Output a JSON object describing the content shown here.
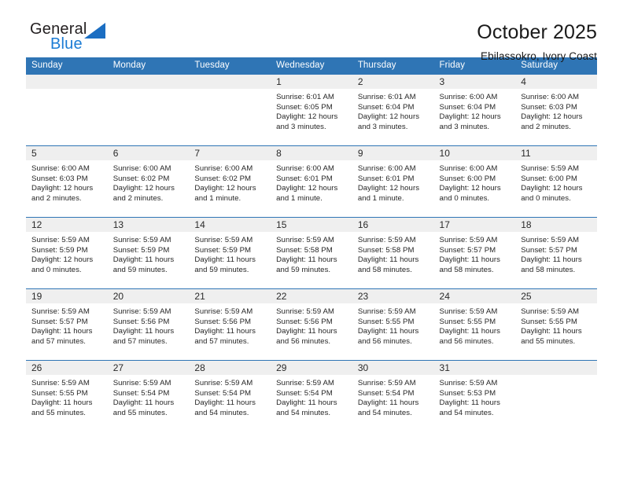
{
  "brand": {
    "name_top": "General",
    "name_bottom": "Blue",
    "triangle_color": "#1b6ec2",
    "blue_color": "#1b7bd4"
  },
  "header": {
    "title": "October 2025",
    "location": "Ebilassokro, Ivory Coast"
  },
  "theme": {
    "header_blue": "#2f75b5",
    "daynum_gray": "#efefef"
  },
  "calendar": {
    "weekdays": [
      "Sunday",
      "Monday",
      "Tuesday",
      "Wednesday",
      "Thursday",
      "Friday",
      "Saturday"
    ],
    "weeks": [
      [
        {
          "day": "",
          "blank": true
        },
        {
          "day": "",
          "blank": true
        },
        {
          "day": "",
          "blank": true
        },
        {
          "day": "1",
          "sunrise": "Sunrise: 6:01 AM",
          "sunset": "Sunset: 6:05 PM",
          "daylight": "Daylight: 12 hours and 3 minutes."
        },
        {
          "day": "2",
          "sunrise": "Sunrise: 6:01 AM",
          "sunset": "Sunset: 6:04 PM",
          "daylight": "Daylight: 12 hours and 3 minutes."
        },
        {
          "day": "3",
          "sunrise": "Sunrise: 6:00 AM",
          "sunset": "Sunset: 6:04 PM",
          "daylight": "Daylight: 12 hours and 3 minutes."
        },
        {
          "day": "4",
          "sunrise": "Sunrise: 6:00 AM",
          "sunset": "Sunset: 6:03 PM",
          "daylight": "Daylight: 12 hours and 2 minutes."
        }
      ],
      [
        {
          "day": "5",
          "sunrise": "Sunrise: 6:00 AM",
          "sunset": "Sunset: 6:03 PM",
          "daylight": "Daylight: 12 hours and 2 minutes."
        },
        {
          "day": "6",
          "sunrise": "Sunrise: 6:00 AM",
          "sunset": "Sunset: 6:02 PM",
          "daylight": "Daylight: 12 hours and 2 minutes."
        },
        {
          "day": "7",
          "sunrise": "Sunrise: 6:00 AM",
          "sunset": "Sunset: 6:02 PM",
          "daylight": "Daylight: 12 hours and 1 minute."
        },
        {
          "day": "8",
          "sunrise": "Sunrise: 6:00 AM",
          "sunset": "Sunset: 6:01 PM",
          "daylight": "Daylight: 12 hours and 1 minute."
        },
        {
          "day": "9",
          "sunrise": "Sunrise: 6:00 AM",
          "sunset": "Sunset: 6:01 PM",
          "daylight": "Daylight: 12 hours and 1 minute."
        },
        {
          "day": "10",
          "sunrise": "Sunrise: 6:00 AM",
          "sunset": "Sunset: 6:00 PM",
          "daylight": "Daylight: 12 hours and 0 minutes."
        },
        {
          "day": "11",
          "sunrise": "Sunrise: 5:59 AM",
          "sunset": "Sunset: 6:00 PM",
          "daylight": "Daylight: 12 hours and 0 minutes."
        }
      ],
      [
        {
          "day": "12",
          "sunrise": "Sunrise: 5:59 AM",
          "sunset": "Sunset: 5:59 PM",
          "daylight": "Daylight: 12 hours and 0 minutes."
        },
        {
          "day": "13",
          "sunrise": "Sunrise: 5:59 AM",
          "sunset": "Sunset: 5:59 PM",
          "daylight": "Daylight: 11 hours and 59 minutes."
        },
        {
          "day": "14",
          "sunrise": "Sunrise: 5:59 AM",
          "sunset": "Sunset: 5:59 PM",
          "daylight": "Daylight: 11 hours and 59 minutes."
        },
        {
          "day": "15",
          "sunrise": "Sunrise: 5:59 AM",
          "sunset": "Sunset: 5:58 PM",
          "daylight": "Daylight: 11 hours and 59 minutes."
        },
        {
          "day": "16",
          "sunrise": "Sunrise: 5:59 AM",
          "sunset": "Sunset: 5:58 PM",
          "daylight": "Daylight: 11 hours and 58 minutes."
        },
        {
          "day": "17",
          "sunrise": "Sunrise: 5:59 AM",
          "sunset": "Sunset: 5:57 PM",
          "daylight": "Daylight: 11 hours and 58 minutes."
        },
        {
          "day": "18",
          "sunrise": "Sunrise: 5:59 AM",
          "sunset": "Sunset: 5:57 PM",
          "daylight": "Daylight: 11 hours and 58 minutes."
        }
      ],
      [
        {
          "day": "19",
          "sunrise": "Sunrise: 5:59 AM",
          "sunset": "Sunset: 5:57 PM",
          "daylight": "Daylight: 11 hours and 57 minutes."
        },
        {
          "day": "20",
          "sunrise": "Sunrise: 5:59 AM",
          "sunset": "Sunset: 5:56 PM",
          "daylight": "Daylight: 11 hours and 57 minutes."
        },
        {
          "day": "21",
          "sunrise": "Sunrise: 5:59 AM",
          "sunset": "Sunset: 5:56 PM",
          "daylight": "Daylight: 11 hours and 57 minutes."
        },
        {
          "day": "22",
          "sunrise": "Sunrise: 5:59 AM",
          "sunset": "Sunset: 5:56 PM",
          "daylight": "Daylight: 11 hours and 56 minutes."
        },
        {
          "day": "23",
          "sunrise": "Sunrise: 5:59 AM",
          "sunset": "Sunset: 5:55 PM",
          "daylight": "Daylight: 11 hours and 56 minutes."
        },
        {
          "day": "24",
          "sunrise": "Sunrise: 5:59 AM",
          "sunset": "Sunset: 5:55 PM",
          "daylight": "Daylight: 11 hours and 56 minutes."
        },
        {
          "day": "25",
          "sunrise": "Sunrise: 5:59 AM",
          "sunset": "Sunset: 5:55 PM",
          "daylight": "Daylight: 11 hours and 55 minutes."
        }
      ],
      [
        {
          "day": "26",
          "sunrise": "Sunrise: 5:59 AM",
          "sunset": "Sunset: 5:55 PM",
          "daylight": "Daylight: 11 hours and 55 minutes."
        },
        {
          "day": "27",
          "sunrise": "Sunrise: 5:59 AM",
          "sunset": "Sunset: 5:54 PM",
          "daylight": "Daylight: 11 hours and 55 minutes."
        },
        {
          "day": "28",
          "sunrise": "Sunrise: 5:59 AM",
          "sunset": "Sunset: 5:54 PM",
          "daylight": "Daylight: 11 hours and 54 minutes."
        },
        {
          "day": "29",
          "sunrise": "Sunrise: 5:59 AM",
          "sunset": "Sunset: 5:54 PM",
          "daylight": "Daylight: 11 hours and 54 minutes."
        },
        {
          "day": "30",
          "sunrise": "Sunrise: 5:59 AM",
          "sunset": "Sunset: 5:54 PM",
          "daylight": "Daylight: 11 hours and 54 minutes."
        },
        {
          "day": "31",
          "sunrise": "Sunrise: 5:59 AM",
          "sunset": "Sunset: 5:53 PM",
          "daylight": "Daylight: 11 hours and 54 minutes."
        },
        {
          "day": "",
          "blank": true
        }
      ]
    ]
  }
}
